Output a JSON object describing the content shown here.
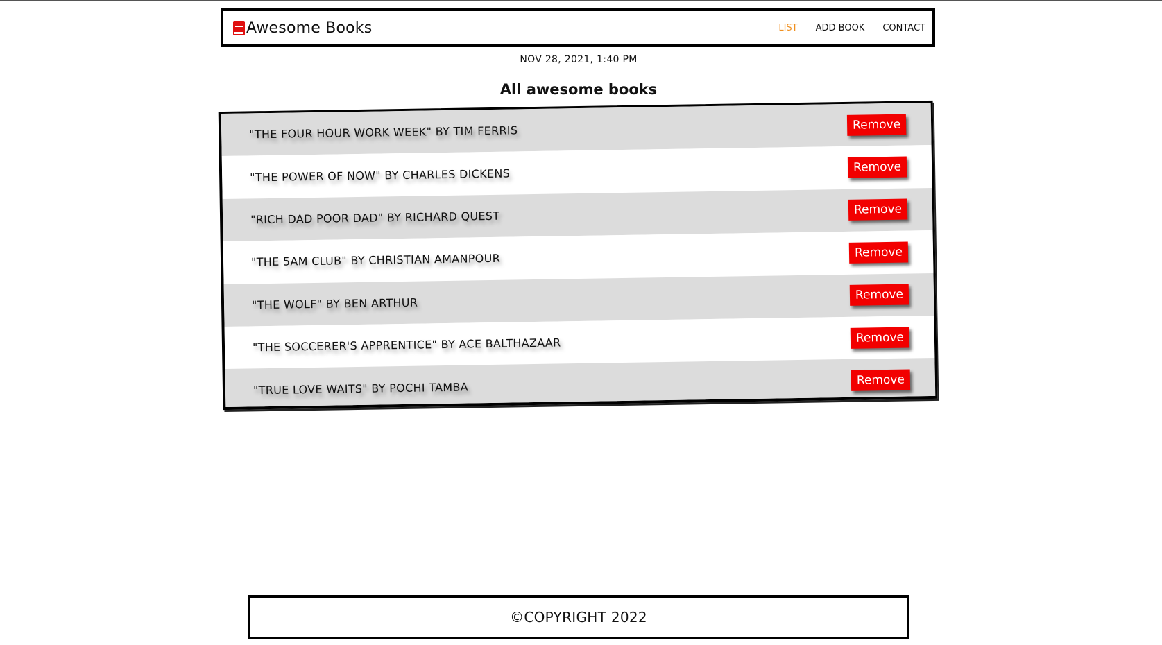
{
  "header": {
    "title": "Awesome Books",
    "nav": [
      {
        "label": "LIST",
        "active": true
      },
      {
        "label": "ADD BOOK",
        "active": false
      },
      {
        "label": "CONTACT",
        "active": false
      }
    ]
  },
  "datetime": "NOV 28, 2021, 1:40 PM",
  "section_title": "All awesome books",
  "books": [
    {
      "text": "\"THE FOUR HOUR WORK WEEK\" BY TIM FERRIS",
      "button": "Remove"
    },
    {
      "text": "\"THE POWER OF NOW\" BY CHARLES DICKENS",
      "button": "Remove"
    },
    {
      "text": "\"RICH DAD POOR DAD\" BY RICHARD QUEST",
      "button": "Remove"
    },
    {
      "text": "\"THE 5AM CLUB\" BY CHRISTIAN AMANPOUR",
      "button": "Remove"
    },
    {
      "text": "\"THE WOLF\" BY BEN ARTHUR",
      "button": "Remove"
    },
    {
      "text": "\"THE SOCCERER'S APPRENTICE\" BY ACE BALTHAZAAR",
      "button": "Remove"
    },
    {
      "text": "\"TRUE LOVE WAITS\" BY POCHI TAMBA",
      "button": "Remove"
    }
  ],
  "footer": {
    "text": "©COPYRIGHT 2022"
  },
  "colors": {
    "accent": "#f0901f",
    "remove": "#f20000",
    "row_alt": "#dcdcdc"
  }
}
